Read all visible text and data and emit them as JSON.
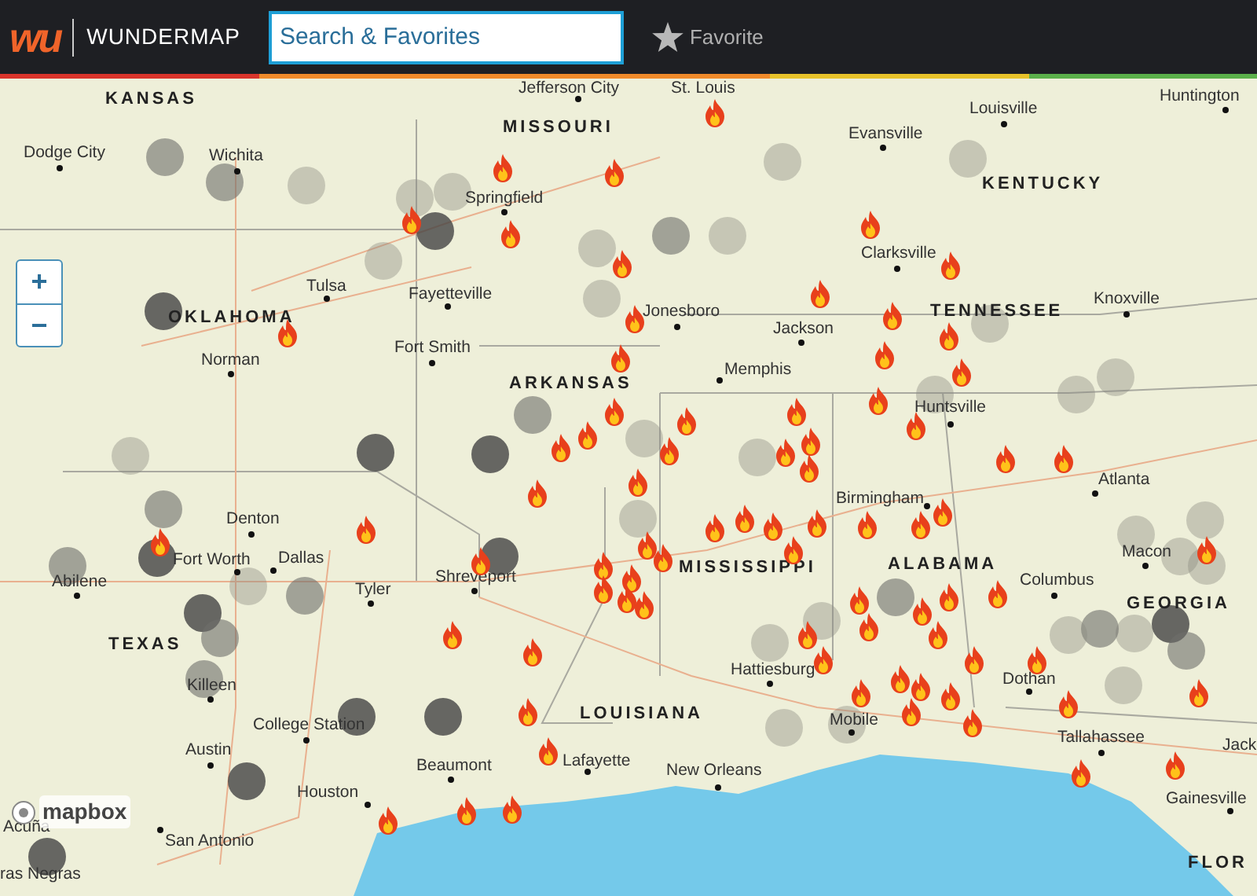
{
  "header": {
    "logo": "wu",
    "title": "WUNDERMAP",
    "search": {
      "placeholder": "Search & Favorites"
    },
    "favorite_button": {
      "label": "Favorite"
    }
  },
  "map": {
    "zoom_controls": [
      {
        "label": "+"
      },
      {
        "label": "−"
      }
    ],
    "state_labels": [
      "KANSAS",
      "MISSOURI",
      "KENTUCKY",
      "OKLAHOMA",
      "TENNESSEE",
      "ARKANSAS",
      "MISSISSIPPI",
      "ALABAMA",
      "TEXAS",
      "GEORGIA",
      "LOUISIANA",
      "FLOR"
    ],
    "city_labels": [
      "Jefferson City",
      "St. Louis",
      "Louisville",
      "Huntington",
      "Dodge City",
      "Wichita",
      "Evansville",
      "Springfield",
      "Clarksville",
      "Tulsa",
      "Fayetteville",
      "Jonesboro",
      "Jackson",
      "Knoxville",
      "Fort Smith",
      "Norman",
      "Memphis",
      "Huntsville",
      "Atlanta",
      "Birmingham",
      "Denton",
      "Fort Worth",
      "Dallas",
      "Abilene",
      "Tyler",
      "Shreveport",
      "Macon",
      "Columbus",
      "Killeen",
      "Hattiesburg",
      "Dothan",
      "College Station",
      "Mobile",
      "Austin",
      "Tallahassee",
      "Jack",
      "Houston",
      "Beaumont",
      "Lafayette",
      "New Orleans",
      "Gainesville",
      "San Antonio",
      "Acuña",
      "ras Negras"
    ],
    "attribution": "mapbox"
  }
}
